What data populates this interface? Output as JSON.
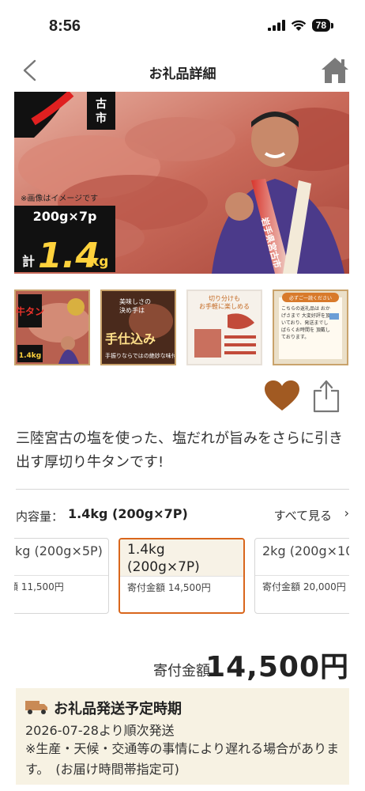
{
  "status": {
    "time": "8:56",
    "battery": "78"
  },
  "nav": {
    "title": "お礼品詳細"
  },
  "hero": {
    "corner_text": "古市",
    "note": "※画像はイメージです",
    "amount": "200g×7p",
    "total_prefix": "計",
    "total_value": "1.4",
    "total_unit": "kg",
    "sash_text": "岩手県宮古市"
  },
  "thumbs": [
    {
      "badge": "牛タン",
      "sub": "1.4kg"
    },
    {
      "line1": "美味しさの",
      "line2": "決め手は",
      "main": "手仕込み",
      "sub": "手振りならではの絶妙な味付け"
    },
    {
      "line1": "切り分けも",
      "line2": "お手軽に楽しめる"
    },
    {
      "header": "必ずご一読ください",
      "body": "こちらの返礼品は おかげさまで 大変好評を頂いており、発送までしばらくお時間を 頂戴しております。"
    }
  ],
  "description": "三陸宮古の塩を使った、塩だれが旨みをさらに引き出す厚切り牛タンです!",
  "variant": {
    "label": "内容量：",
    "value": "1.4kg (200g×7P)",
    "see_all": "すべて見る",
    "options": [
      {
        "name": "kg (200g×5P)",
        "price": "寄付金額 11,500円"
      },
      {
        "name": "1.4kg (200g×7P)",
        "price": "寄付金額 14,500円"
      },
      {
        "name": "2kg (200g×10",
        "price": "寄付金額 20,000円"
      }
    ]
  },
  "price": {
    "label": "寄付金額",
    "amount": "14,500円"
  },
  "shipping": {
    "heading": "お礼品発送予定時期",
    "date": "2026-07-28より順次発送",
    "note": "※生産・天候・交通等の事情により遅れる場合があります。　(お届け時間帯指定可)"
  },
  "colors": {
    "accent": "#d9661c",
    "heart": "#a15a22",
    "cream": "#f7f2e3"
  }
}
